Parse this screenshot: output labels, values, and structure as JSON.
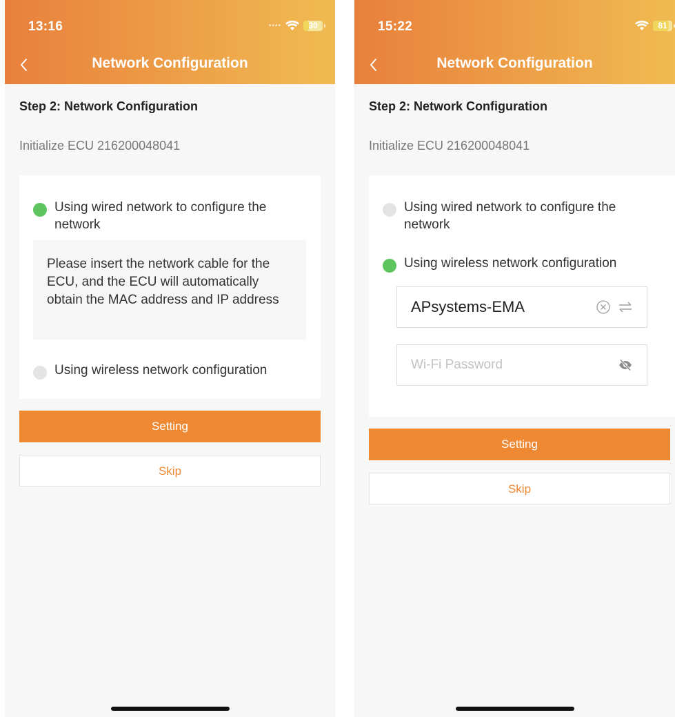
{
  "screens": [
    {
      "status": {
        "time": "13:16",
        "battery": "30",
        "battery_level": 0.3
      },
      "header": {
        "title": "Network Configuration"
      },
      "step_title": "Step 2: Network Configuration",
      "initialize": "Initialize ECU 216200048041",
      "options": {
        "wired": {
          "label": "Using wired network to configure the network",
          "selected": true
        },
        "wireless": {
          "label": "Using wireless network configuration",
          "selected": false
        }
      },
      "wired_info": "Please insert the network cable for the ECU, and the ECU will automatically obtain the MAC address and IP address",
      "buttons": {
        "setting": "Setting",
        "skip": "Skip"
      }
    },
    {
      "status": {
        "time": "15:22",
        "battery": "81",
        "battery_level": 0.81
      },
      "header": {
        "title": "Network Configuration"
      },
      "step_title": "Step 2: Network Configuration",
      "initialize": "Initialize ECU 216200048041",
      "options": {
        "wired": {
          "label": "Using wired network to configure the network",
          "selected": false
        },
        "wireless": {
          "label": "Using wireless network configuration",
          "selected": true
        }
      },
      "wifi": {
        "ssid": "APsystems-EMA",
        "password_placeholder": "Wi-Fi Password",
        "password_value": ""
      },
      "buttons": {
        "setting": "Setting",
        "skip": "Skip"
      }
    }
  ],
  "colors": {
    "accent": "#ee8833",
    "header_gradient_start": "#e8803c",
    "header_gradient_end": "#f0bb52",
    "radio_selected": "#5ec45e",
    "radio_unselected": "#e4e4e4"
  },
  "icons": {
    "back": "chevron-left-icon",
    "wifi": "wifi-icon",
    "battery": "battery-icon",
    "clear": "clear-circle-icon",
    "switch": "switch-arrows-icon",
    "visibility": "eye-off-icon"
  }
}
